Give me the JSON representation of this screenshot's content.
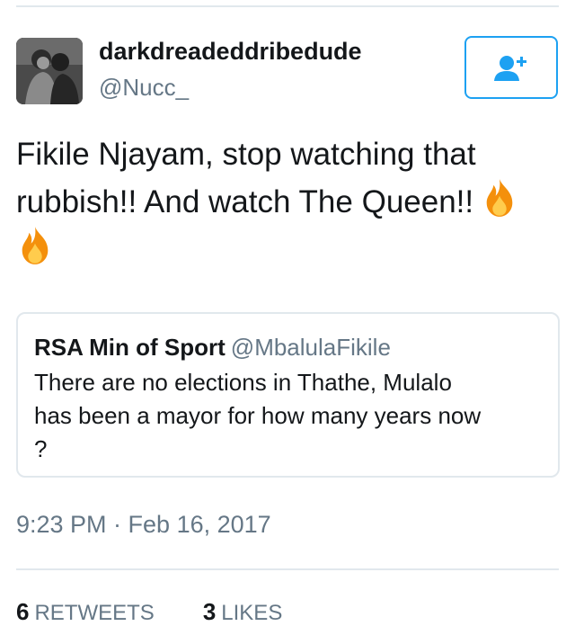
{
  "tweet": {
    "author": {
      "display_name": "darkdreadeddribedude",
      "handle": "@Nucc_"
    },
    "follow_icon": "add-user-icon",
    "text_lines": [
      "Fikile Njayam, stop watching that",
      "rubbish!! And watch The Queen!!"
    ],
    "emoji": "fire",
    "quoted": {
      "name": "RSA Min of Sport",
      "handle": "@MbalulaFikile",
      "text_lines": [
        "There are no elections in Thathe, Mulalo",
        "has been a mayor for how many years now",
        "?"
      ]
    },
    "timestamp": "9:23 PM · Feb 16, 2017",
    "retweets": {
      "count": "6",
      "label": "RETWEETS"
    },
    "likes": {
      "count": "3",
      "label": "LIKES"
    }
  },
  "colors": {
    "accent": "#1da1f2",
    "secondary_text": "#657786",
    "primary_text": "#14171a",
    "divider": "#e1e8ed",
    "fire_outer": "#f4900c",
    "fire_inner": "#ffcc4d"
  }
}
